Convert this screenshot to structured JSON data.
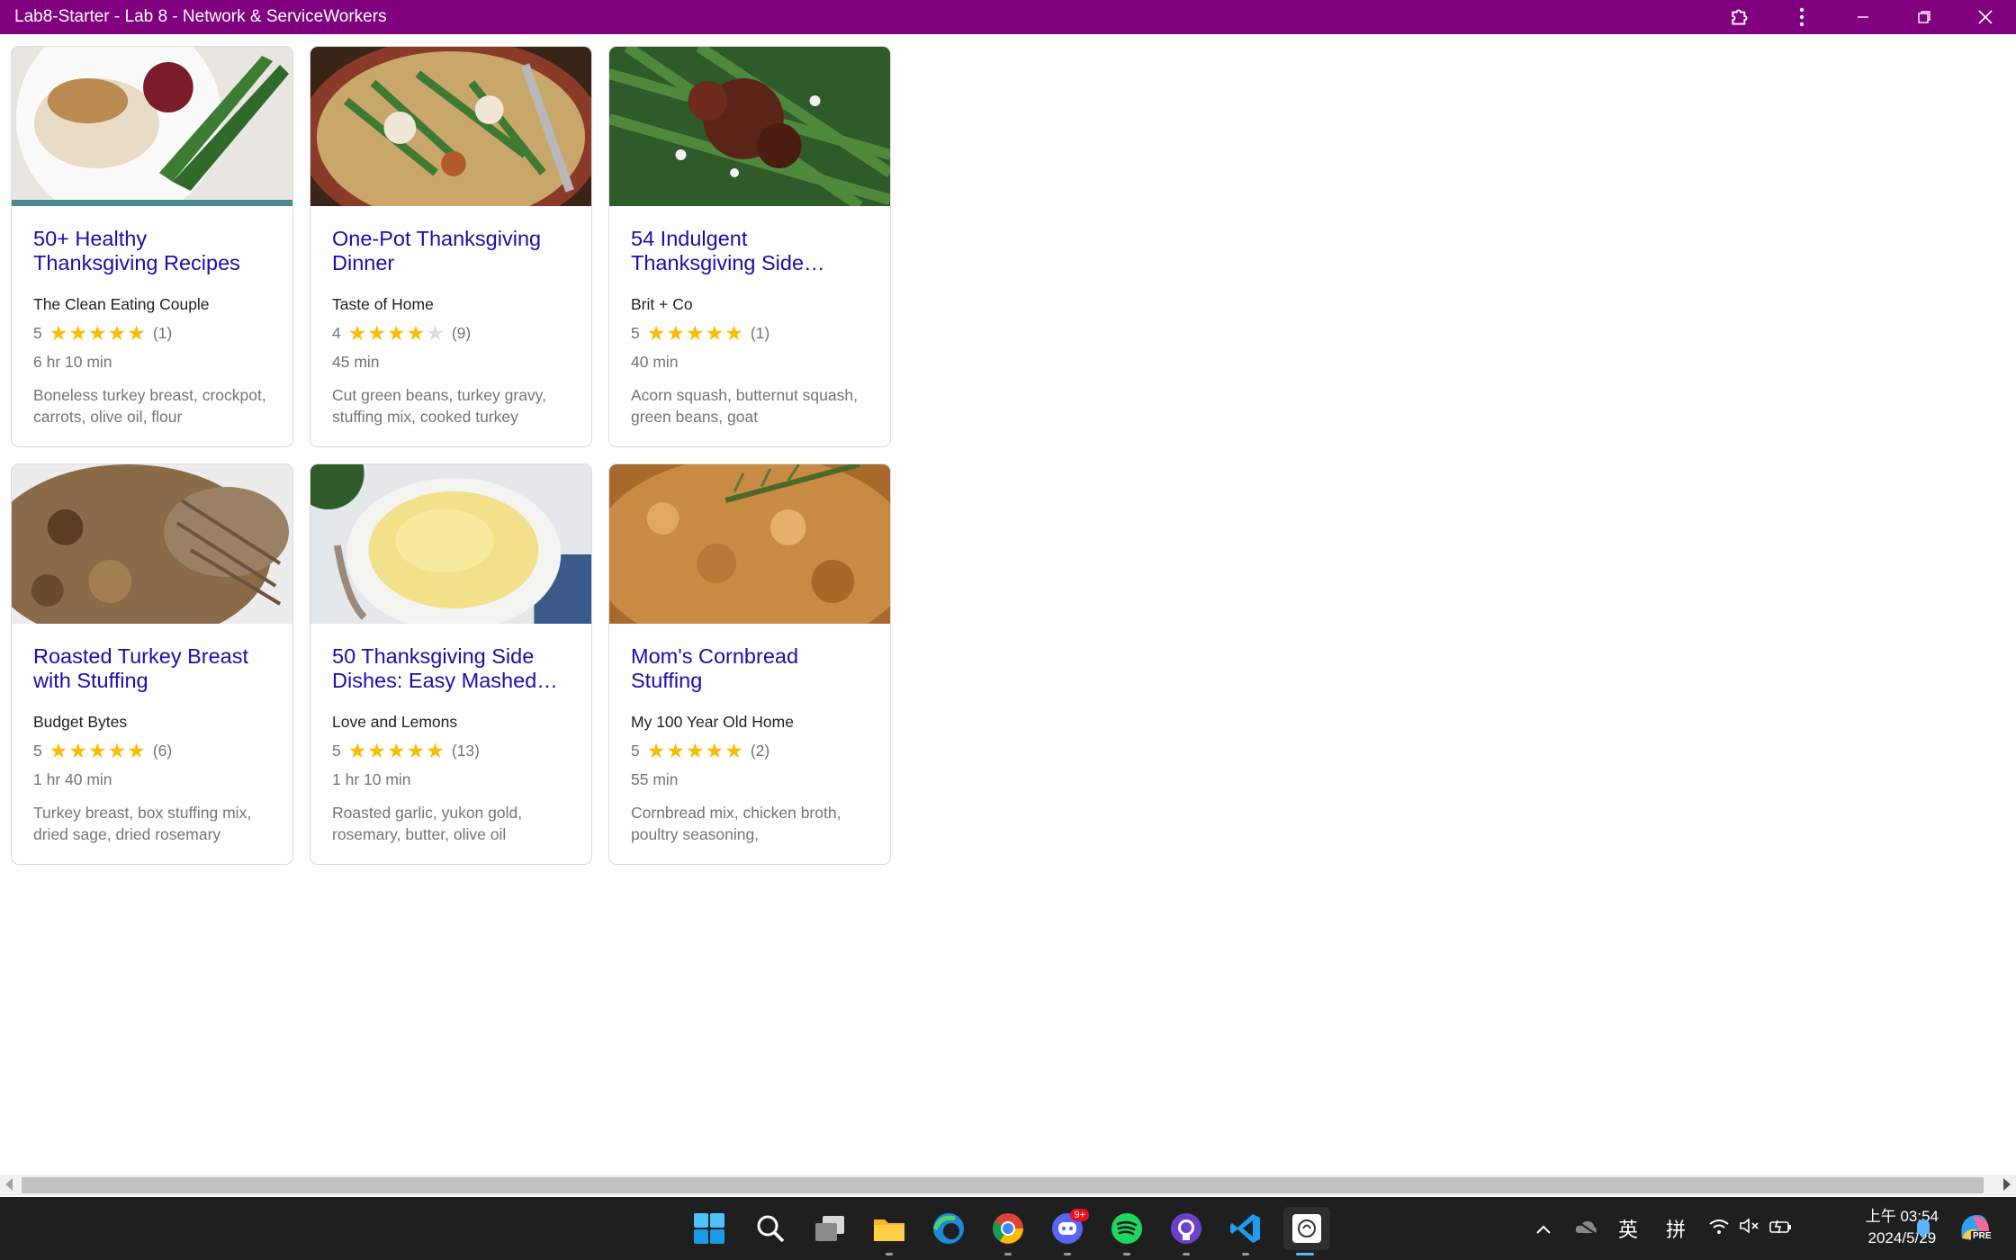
{
  "window": {
    "title": "Lab8-Starter - Lab 8 - Network & ServiceWorkers"
  },
  "recipes": [
    {
      "name": "50+ Healthy Thanksgiving Recipes",
      "org": "The Clean Eating Couple",
      "rating": 5,
      "reviews": "(1)",
      "time": "6 hr 10 min",
      "ingredients": "Boneless turkey breast, crockpot, carrots, olive oil, flour"
    },
    {
      "name": "One-Pot Thanksgiving Dinner",
      "org": "Taste of Home",
      "rating": 4,
      "reviews": "(9)",
      "time": "45 min",
      "ingredients": "Cut green beans, turkey gravy, stuffing mix, cooked turkey"
    },
    {
      "name": "54 Indulgent Thanksgiving Side…",
      "org": "Brit + Co",
      "rating": 5,
      "reviews": "(1)",
      "time": "40 min",
      "ingredients": "Acorn squash, butternut squash, green beans, goat"
    },
    {
      "name": "Roasted Turkey Breast with Stuffing",
      "org": "Budget Bytes",
      "rating": 5,
      "reviews": "(6)",
      "time": "1 hr 40 min",
      "ingredients": "Turkey breast, box stuffing mix, dried sage, dried rosemary"
    },
    {
      "name": "50 Thanksgiving Side Dishes: Easy Mashed…",
      "org": "Love and Lemons",
      "rating": 5,
      "reviews": "(13)",
      "time": "1 hr 10 min",
      "ingredients": "Roasted garlic, yukon gold, rosemary, butter, olive oil"
    },
    {
      "name": "Mom's Cornbread Stuffing",
      "org": "My 100 Year Old Home",
      "rating": 5,
      "reviews": "(2)",
      "time": "55 min",
      "ingredients": "Cornbread mix, chicken broth, poultry seasoning,"
    }
  ],
  "taskbar": {
    "discord_badge": "9+",
    "ime_lang": "英",
    "ime_mode": "拼",
    "time": "上午 03:54",
    "date": "2024/5/29",
    "copilot_label": "PRE"
  },
  "colors": {
    "titlebar": "#800080",
    "link": "#1a0dab",
    "star": "#fbbc04"
  }
}
